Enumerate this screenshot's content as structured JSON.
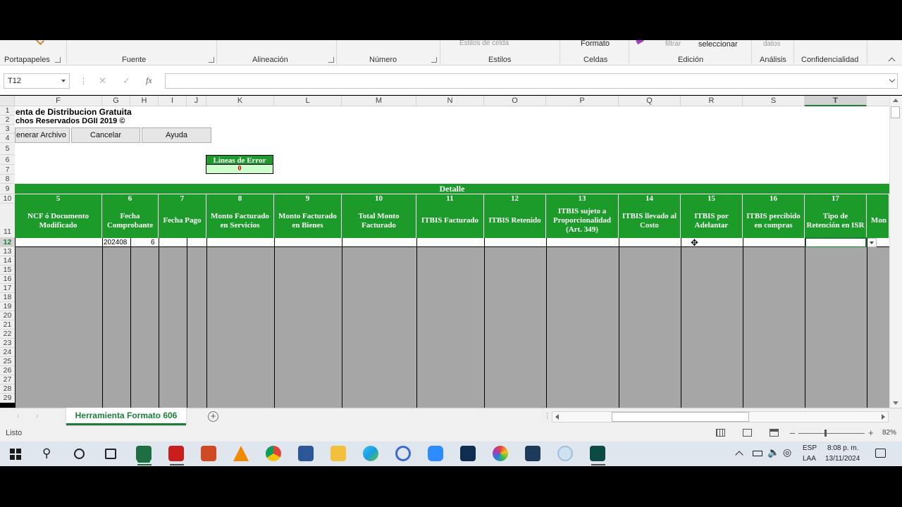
{
  "ribbon": {
    "groups": [
      "Portapapeles",
      "Fuente",
      "Alineación",
      "Número",
      "Estilos",
      "Celdas",
      "Edición",
      "Análisis",
      "Confidencialidad"
    ],
    "faint_items": {
      "estilos_celda": "Estilos de celda",
      "formato": "Formato",
      "filtrar": "filtrar",
      "datos": "datos"
    },
    "seleccionar": "seleccionar"
  },
  "formula_bar": {
    "name_box": "T12",
    "fx": "fx",
    "formula": ""
  },
  "columns": [
    "F",
    "G",
    "H",
    "I",
    "J",
    "K",
    "L",
    "M",
    "N",
    "O",
    "P",
    "Q",
    "R",
    "S",
    "T"
  ],
  "rows": [
    "1",
    "2",
    "3",
    "4",
    "5",
    "6",
    "7",
    "8",
    "9",
    "10",
    "11",
    "12",
    "13",
    "14",
    "15",
    "16",
    "17",
    "18",
    "19",
    "20",
    "21",
    "22",
    "23",
    "24",
    "25",
    "26",
    "27",
    "28",
    "29"
  ],
  "sheet": {
    "title": "enta de Distribucion Gratuita",
    "copyright": "chos Reservados DGII 2019 ©",
    "buttons": {
      "generar": "enerar Archivo",
      "cancelar": "Cancelar",
      "ayuda": "Ayuda"
    },
    "error_label": "Lineas de Error",
    "error_value": "0",
    "detalle": "Detalle",
    "col_numbers": [
      "5",
      "6",
      "7",
      "8",
      "9",
      "10",
      "11",
      "12",
      "13",
      "14",
      "15",
      "16",
      "17"
    ],
    "headers": [
      "NCF ó Documento Modificado",
      "Fecha Comprobante",
      "Fecha Pago",
      "Monto Facturado en Servicios",
      "Monto Facturado en Bienes",
      "Total Monto Facturado",
      "ITBIS Facturado",
      "ITBIS Retenido",
      "ITBIS sujeto a Proporcionalidad (Art. 349)",
      "ITBIS llevado al Costo",
      "ITBIS por Adelantar",
      "ITBIS percibido en compras",
      "Tipo de Retención en ISR",
      "Mon"
    ],
    "row12": {
      "g": "202408",
      "h": "6"
    }
  },
  "sheet_tab": "Herramienta Formato 606",
  "status": {
    "text": "Listo",
    "zoom": "82%"
  },
  "taskbar": {
    "lang1": "ESP",
    "lang2": "LAA",
    "time": "8:08 p. m.",
    "date": "13/11/2024"
  }
}
